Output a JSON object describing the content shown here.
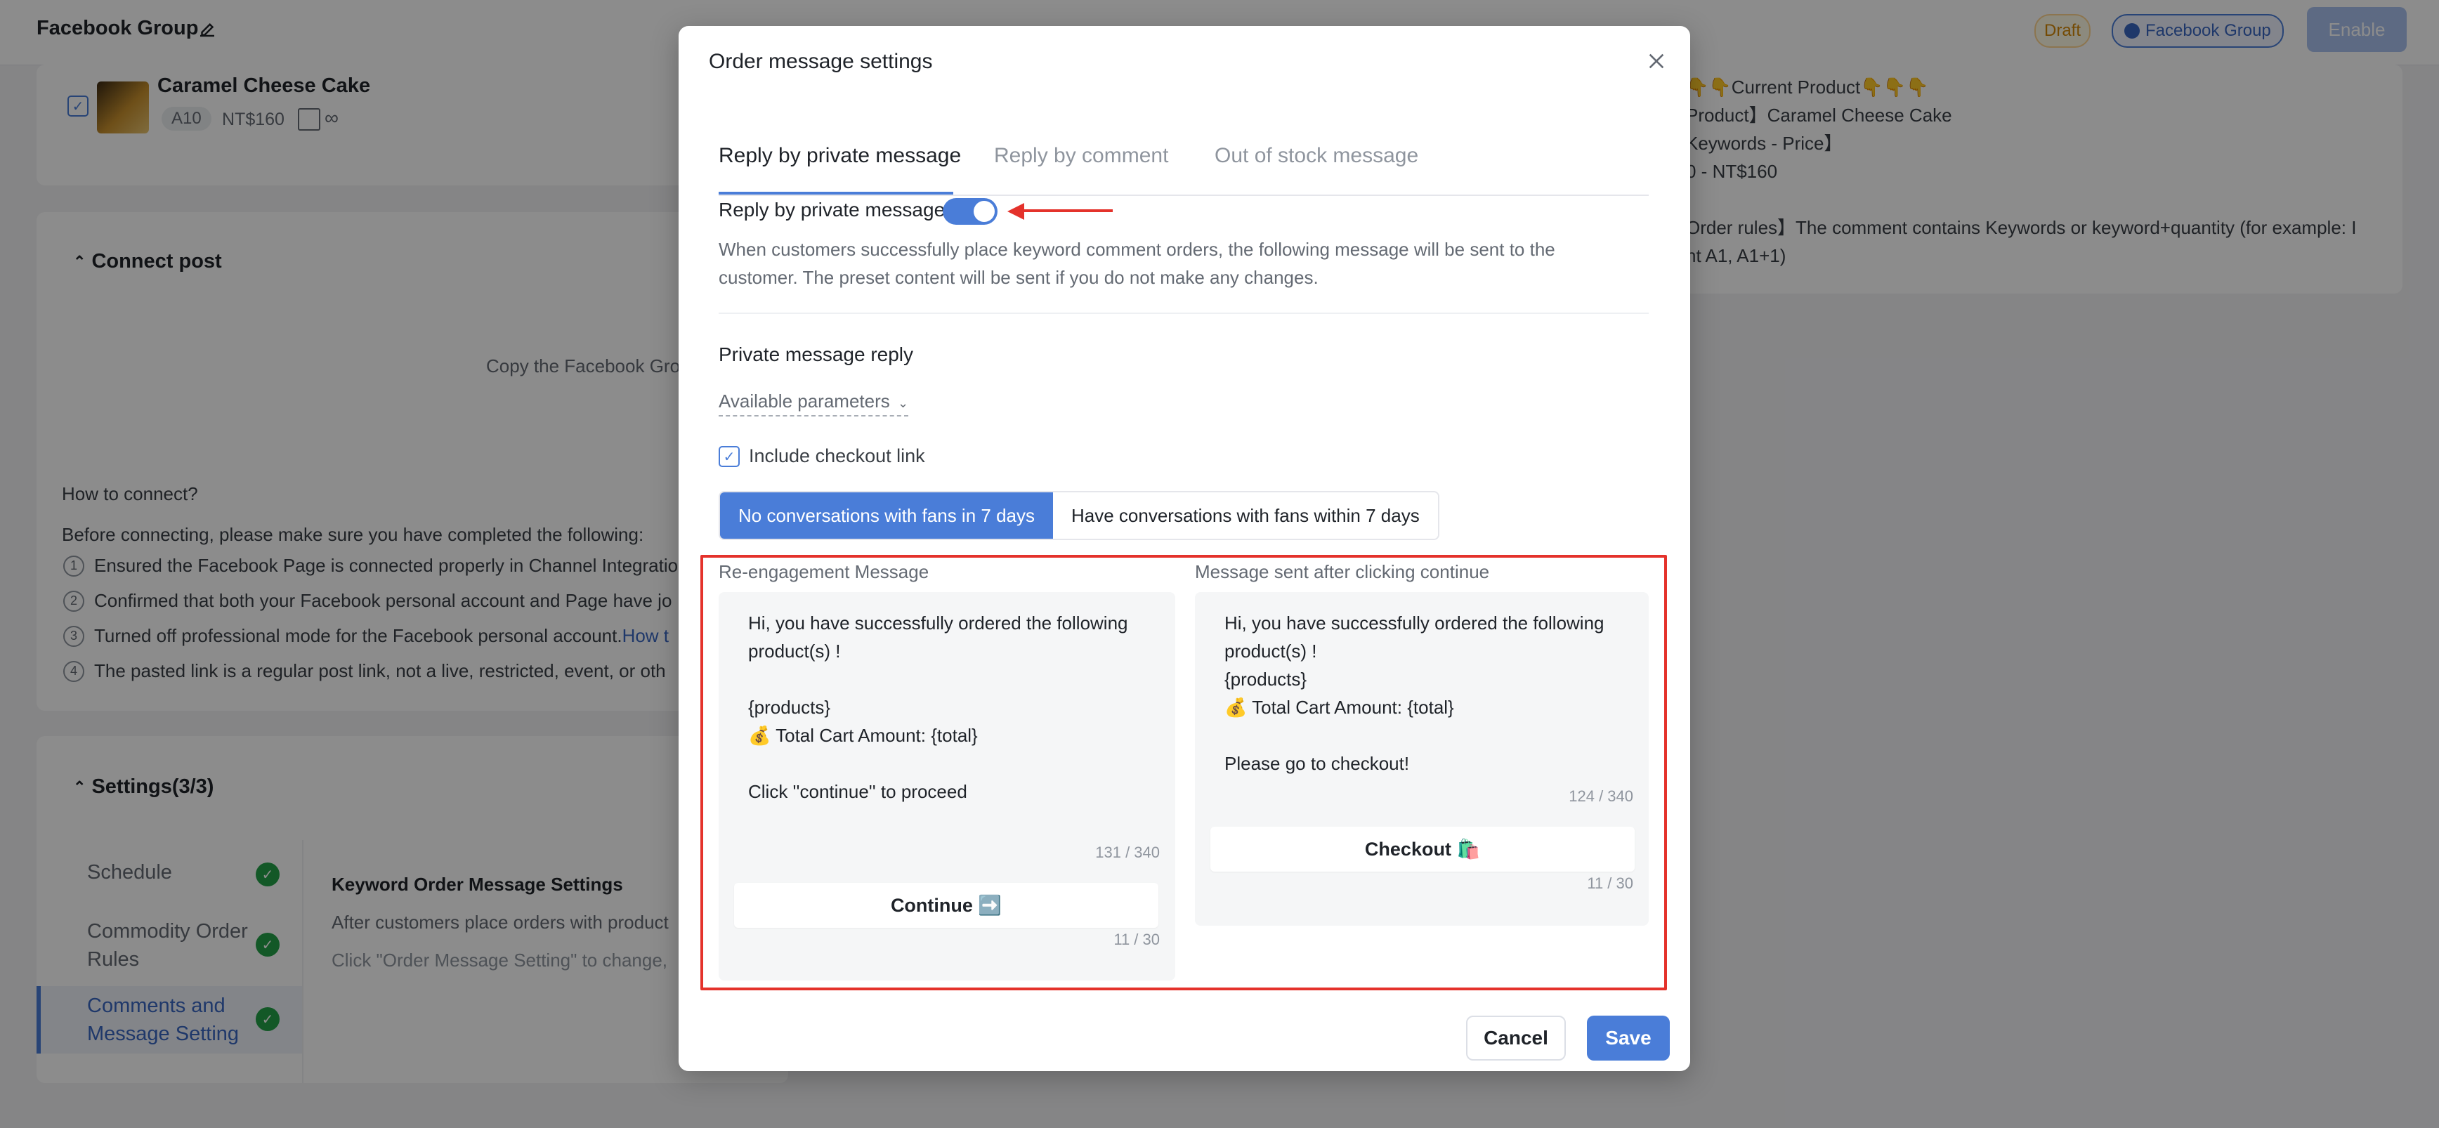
{
  "topbar": {
    "title": "Facebook Group",
    "badge_draft": "Draft",
    "badge_group": "Facebook Group",
    "enable_label": "Enable"
  },
  "product": {
    "name": "Caramel Cheese Cake",
    "code": "A10",
    "price": "NT$160",
    "stock": "∞"
  },
  "connect": {
    "title": "Connect post",
    "copy_hint": "Copy the Facebook Grou",
    "how_to": "How to connect?",
    "before": "Before connecting, please make sure you have completed the following:",
    "steps": [
      "Ensured the Facebook Page is connected properly in Channel Integratio",
      "Confirmed that both your Facebook personal account and Page have jo",
      "Turned off professional mode for the Facebook personal account.",
      "The pasted link is a regular post link, not a live, restricted, event, or oth"
    ],
    "step3_link": "How t"
  },
  "settings": {
    "title": "Settings(3/3)",
    "items": [
      {
        "label": "Schedule"
      },
      {
        "label": "Commodity Order Rules"
      },
      {
        "label": "Comments and Message Setting"
      }
    ],
    "content_title": "Keyword Order Message Settings",
    "content_line1": "After customers place orders with product",
    "content_line2": "Click \"Order Message Setting\" to change,"
  },
  "preview": {
    "lines": [
      "👇👇Current Product👇👇👇",
      "Product】Caramel Cheese Cake",
      "Keywords - Price】",
      "0 - NT$160",
      "",
      "Order rules】The comment contains Keywords or keyword+quantity (for example: I",
      "nt A1, A1+1)"
    ]
  },
  "modal": {
    "title": "Order message settings",
    "tabs": [
      {
        "label": "Reply by private message"
      },
      {
        "label": "Reply by comment"
      },
      {
        "label": "Out of stock message"
      }
    ],
    "toggle_label": "Reply by private message",
    "toggle_on": true,
    "description": "When customers successfully place keyword comment orders, the following message will be sent to the customer. The preset content will be sent if you do not make any changes.",
    "section_label": "Private message reply",
    "params_label": "Available parameters",
    "checkout_label": "Include checkout link",
    "segments": [
      {
        "label": "No conversations with fans in 7 days"
      },
      {
        "label": "Have conversations with fans within 7 days"
      }
    ],
    "left": {
      "label": "Re-engagement Message",
      "text": "Hi, you have successfully ordered the following product(s) !\n\n{products}\n💰 Total Cart Amount: {total}\n\nClick ''continue'' to proceed",
      "counter": "131 / 340",
      "button": "Continue ➡️",
      "button_counter": "11 / 30"
    },
    "right": {
      "label": "Message sent after clicking continue",
      "text": "Hi, you have successfully ordered the following product(s) !\n{products}\n💰 Total Cart Amount: {total}\n\nPlease go to checkout!",
      "counter": "124 / 340",
      "button": "Checkout 🛍️",
      "button_counter": "11 / 30"
    },
    "cancel": "Cancel",
    "save": "Save"
  },
  "colors": {
    "accent": "#4a7dd8",
    "highlight": "#e4322b",
    "success": "#24a148"
  }
}
